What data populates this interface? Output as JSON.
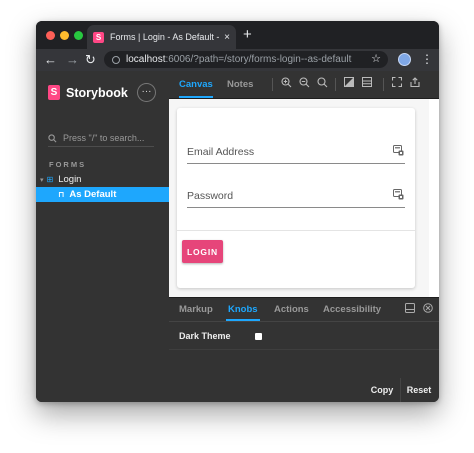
{
  "browser": {
    "tab_title": "Forms | Login - As Default - Storybook",
    "tab_favicon": "S",
    "tab_close": "×",
    "new_tab": "+",
    "url_host": "localhost",
    "url_rest": ":6006/?path=/story/forms-login--as-default",
    "icons": {
      "back": "←",
      "forward": "→",
      "reload": "↻",
      "bookmark": "☆",
      "menu": "⋮"
    }
  },
  "storybook": {
    "brand_logo": "S",
    "brand": "Storybook",
    "menu_icon": "···",
    "search": {
      "placeholder": "Press \"/\" to search..."
    },
    "section": "FORMS",
    "tree": {
      "component": "Login",
      "story": "As Default"
    },
    "toolbar": {
      "tabs": [
        "Canvas",
        "Notes"
      ]
    }
  },
  "form": {
    "email_placeholder": "Email Address",
    "password_placeholder": "Password",
    "login_label": "LOGIN"
  },
  "addons": {
    "tabs": [
      "Markup",
      "Knobs",
      "Actions",
      "Accessibility"
    ],
    "knob_label": "Dark Theme",
    "knob_value": false,
    "copy_label": "Copy",
    "reset_label": "Reset"
  },
  "colors": {
    "accent": "#1ea7fd",
    "brand": "#ff4785",
    "login_button": "#e6457a"
  }
}
